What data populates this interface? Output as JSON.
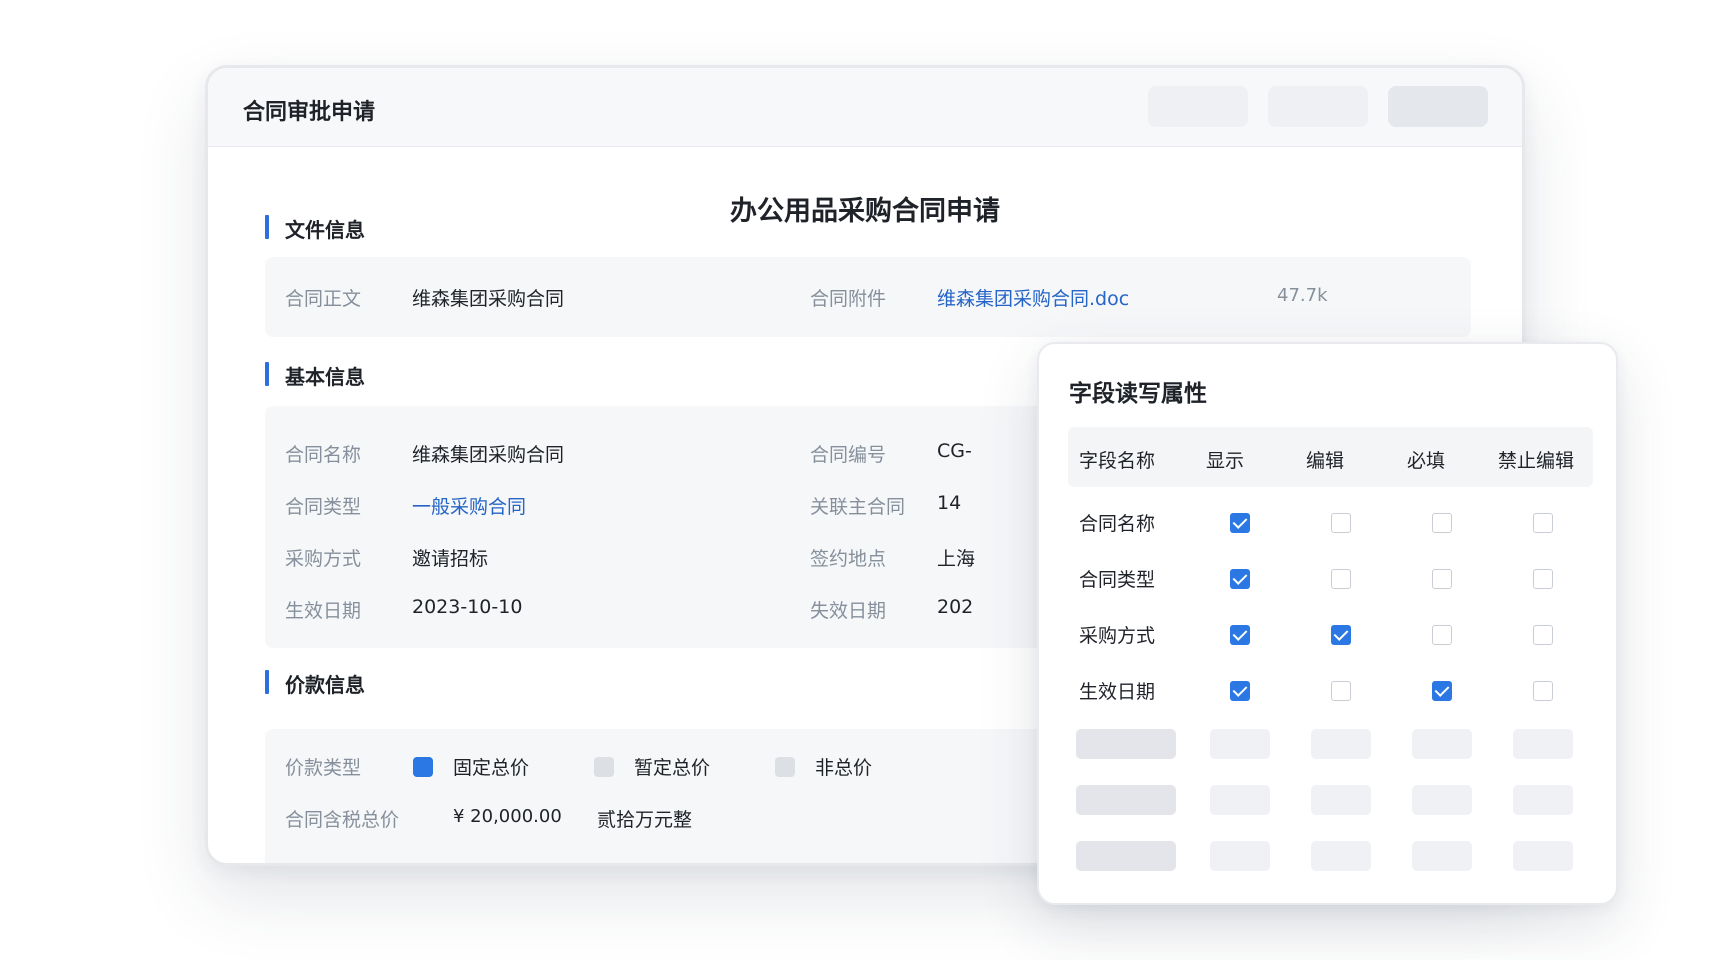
{
  "window": {
    "title": "合同审批申请"
  },
  "form": {
    "title": "办公用品采购合同申请"
  },
  "sections": {
    "file_info": "文件信息",
    "basic_info": "基本信息",
    "price_info": "价款信息"
  },
  "file_info": {
    "body_label": "合同正文",
    "body_value": "维森集团采购合同",
    "attachment_label": "合同附件",
    "attachment_value": "维森集团采购合同.doc",
    "attachment_size": "47.7k"
  },
  "basic_info": {
    "left": [
      {
        "label": "合同名称",
        "value": "维森集团采购合同"
      },
      {
        "label": "合同类型",
        "value": "一般采购合同"
      },
      {
        "label": "采购方式",
        "value": "邀请招标"
      },
      {
        "label": "生效日期",
        "value": "2023-10-10"
      }
    ],
    "right": [
      {
        "label": "合同编号",
        "value": "CG-"
      },
      {
        "label": "关联主合同",
        "value": "14"
      },
      {
        "label": "签约地点",
        "value": "上海"
      },
      {
        "label": "失效日期",
        "value": "202"
      }
    ]
  },
  "price_info": {
    "type_label": "价款类型",
    "options": [
      {
        "label": "固定总价",
        "selected": true
      },
      {
        "label": "暂定总价",
        "selected": false
      },
      {
        "label": "非总价",
        "selected": false
      }
    ],
    "total_label": "合同含税总价",
    "total_value": "¥ 20,000.00",
    "total_words": "贰拾万元整"
  },
  "field_props": {
    "title": "字段读写属性",
    "columns": [
      "字段名称",
      "显示",
      "编辑",
      "必填",
      "禁止编辑"
    ],
    "rows": [
      {
        "name": "合同名称",
        "show": true,
        "edit": false,
        "required": false,
        "readonly": false
      },
      {
        "name": "合同类型",
        "show": true,
        "edit": false,
        "required": false,
        "readonly": false
      },
      {
        "name": "采购方式",
        "show": true,
        "edit": true,
        "required": false,
        "readonly": false
      },
      {
        "name": "生效日期",
        "show": true,
        "edit": false,
        "required": true,
        "readonly": false
      }
    ]
  },
  "colors": {
    "accent": "#2b78e4",
    "link": "#2565c7",
    "section_bar": "#2b6fe0"
  }
}
